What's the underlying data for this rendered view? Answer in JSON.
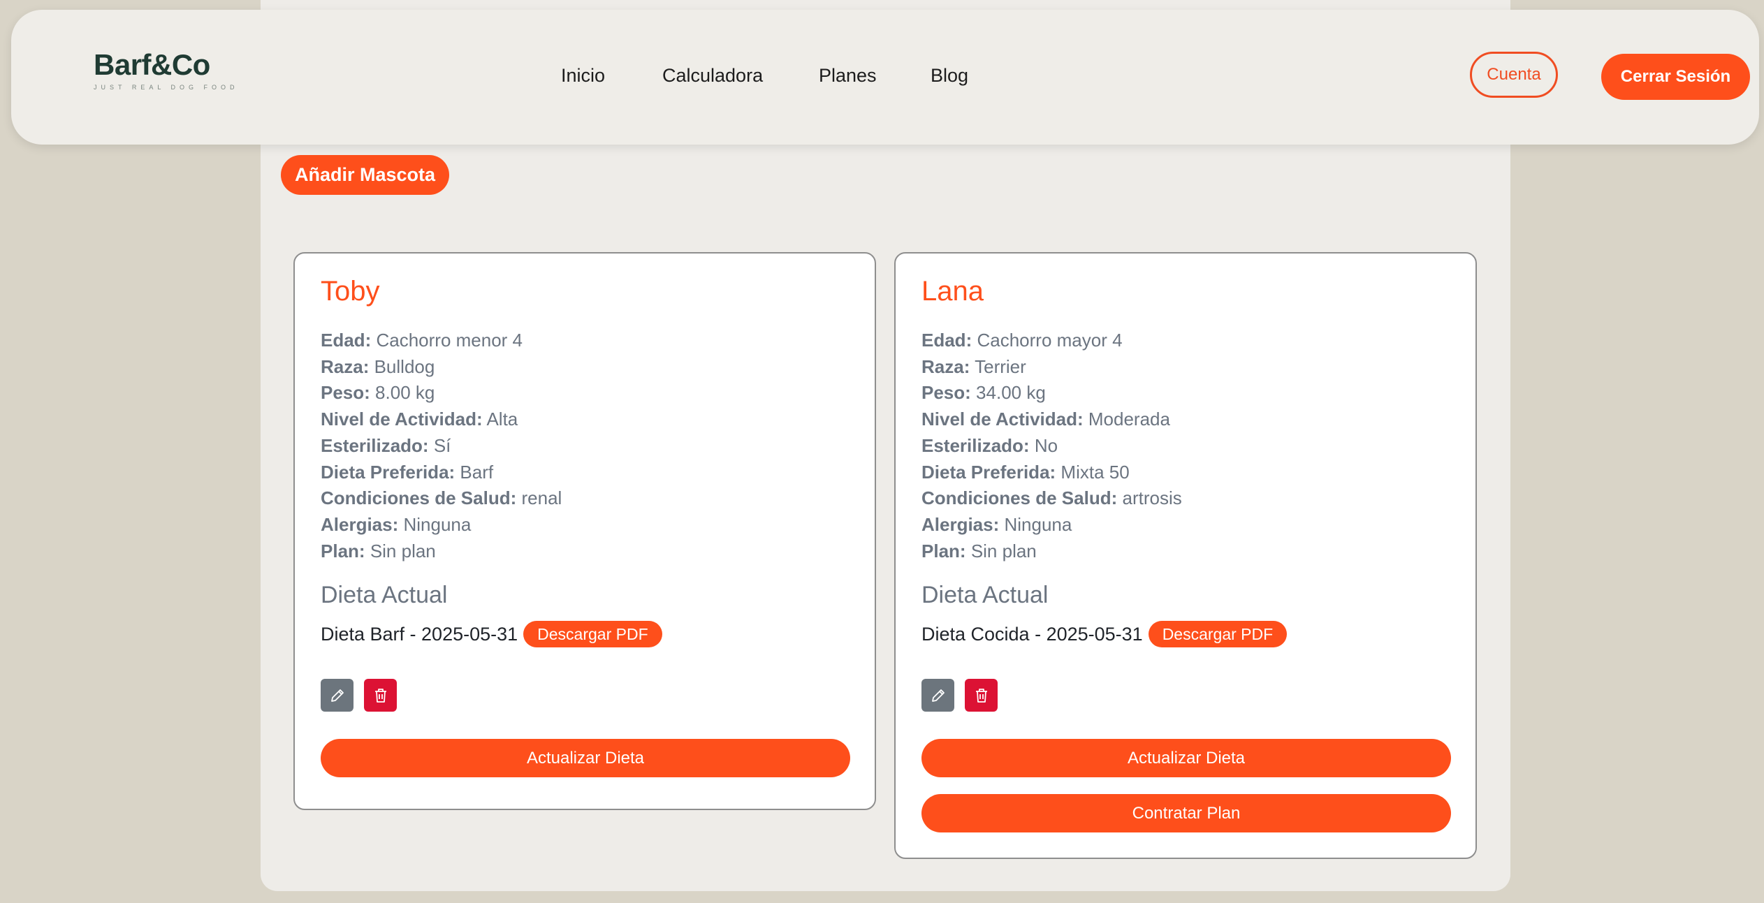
{
  "brand": {
    "name": "Barf&Co",
    "tagline": "JUST REAL DOG FOOD"
  },
  "nav": {
    "links": [
      "Inicio",
      "Calculadora",
      "Planes",
      "Blog"
    ]
  },
  "header_actions": {
    "account": "Cuenta",
    "logout": "Cerrar Sesión"
  },
  "actions": {
    "add_pet": "Añadir Mascota"
  },
  "labels": {
    "age": "Edad:",
    "breed": "Raza:",
    "weight": "Peso:",
    "activity": "Nivel de Actividad:",
    "sterilized": "Esterilizado:",
    "preferred_diet": "Dieta Preferida:",
    "health": "Condiciones de Salud:",
    "allergies": "Alergias:",
    "plan": "Plan:",
    "current_diet": "Dieta Actual",
    "download_pdf": "Descargar PDF",
    "update_diet": "Actualizar Dieta",
    "hire_plan": "Contratar Plan"
  },
  "pets": [
    {
      "name": "Toby",
      "age": "Cachorro menor 4",
      "breed": "Bulldog",
      "weight": "8.00 kg",
      "activity": "Alta",
      "sterilized": "Sí",
      "preferred_diet": "Barf",
      "health": "renal",
      "allergies": "Ninguna",
      "plan": "Sin plan",
      "current_diet": "Dieta Barf - 2025-05-31"
    },
    {
      "name": "Lana",
      "age": "Cachorro mayor 4",
      "breed": "Terrier",
      "weight": "34.00 kg",
      "activity": "Moderada",
      "sterilized": "No",
      "preferred_diet": "Mixta 50",
      "health": "artrosis",
      "allergies": "Ninguna",
      "plan": "Sin plan",
      "current_diet": "Dieta Cocida - 2025-05-31"
    }
  ],
  "colors": {
    "accent": "#fe4f1b",
    "background": "#d9d4c7",
    "panel": "#eeece8",
    "brand_text": "#1f3b33",
    "muted_text": "#6b7480",
    "edit": "#6c757d",
    "delete": "#dc1234"
  },
  "icons": {
    "edit": "pencil-icon",
    "delete": "trash-icon"
  }
}
